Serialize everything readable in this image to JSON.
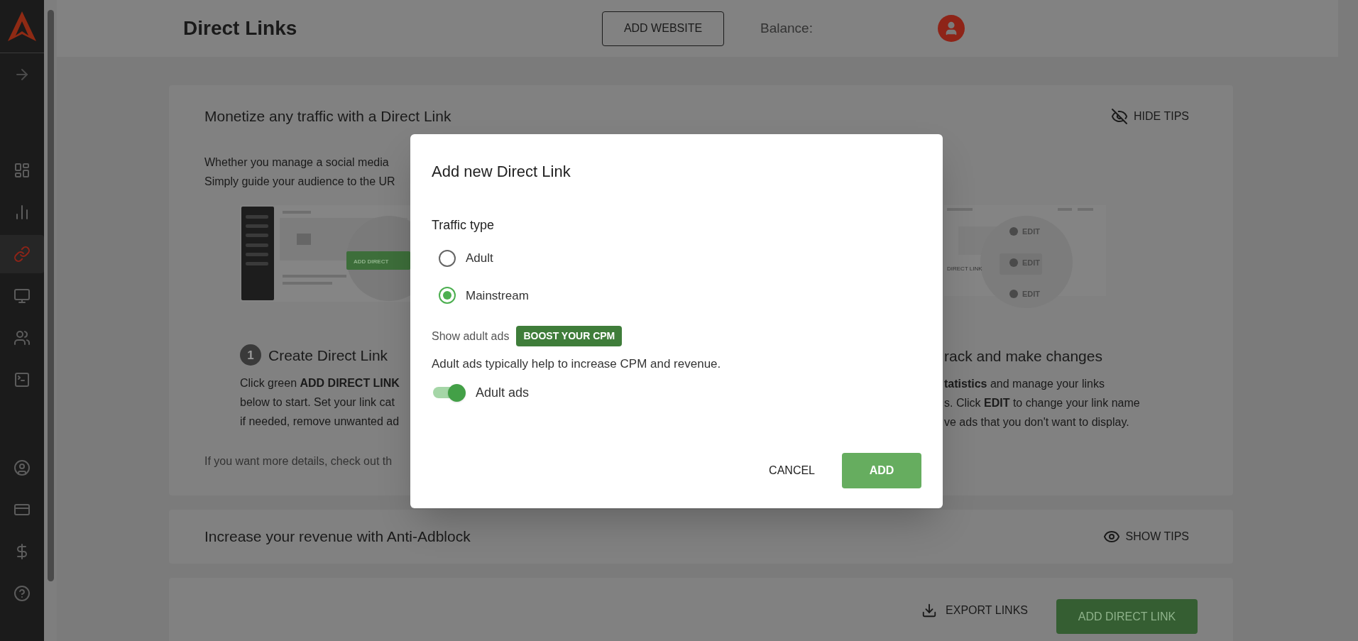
{
  "sidebar": {
    "items": [
      {
        "selected": false
      },
      {
        "selected": false
      },
      {
        "selected": true
      },
      {
        "selected": false
      },
      {
        "selected": false
      },
      {
        "selected": false
      }
    ],
    "bottom_items": [
      {
        "selected": false
      },
      {
        "selected": false
      },
      {
        "selected": false
      },
      {
        "selected": false
      }
    ]
  },
  "header": {
    "title": "Direct Links",
    "add_website": "ADD WEBSITE",
    "balance_label": "Balance:"
  },
  "tips_card": {
    "title": "Monetize any traffic with a Direct Link",
    "toggle": "HIDE TIPS",
    "intro": [
      "Whether you manage a social media",
      "Simply guide your audience to the UR"
    ],
    "illustration_left": {
      "button": "ADD DIRECT"
    },
    "illustration_right": {
      "buttons": [
        "EDIT",
        "EDIT",
        "EDIT"
      ],
      "row_label": "DIRECT LINK"
    },
    "steps": [
      {
        "number": "1",
        "title": "Create Direct Link",
        "lines": [
          "Click green **ADD DIRECT LINK**",
          "below to start. Set your link cat",
          "if needed, remove unwanted ad"
        ]
      },
      {
        "title": "rack and make changes",
        "lines": [
          "**tatistics** and manage your links",
          "s. Click **EDIT** to change your link name",
          "ve ads that you don't want to display."
        ]
      }
    ],
    "footer": "If you want more details, check out th"
  },
  "adblock_card": {
    "title": "Increase your revenue with Anti-Adblock",
    "toggle": "SHOW TIPS"
  },
  "actions": {
    "export": "EXPORT LINKS",
    "add": "ADD DIRECT LINK"
  },
  "dialog": {
    "title": "Add new Direct Link",
    "section": "Traffic type",
    "options": [
      {
        "label": "Adult",
        "selected": false
      },
      {
        "label": "Mainstream",
        "selected": true
      }
    ],
    "adult_ads_label": "Show adult ads",
    "badge": "BOOST YOUR CPM",
    "description": "Adult ads typically help to increase CPM and revenue.",
    "switch": {
      "label": "Adult ads",
      "on": true
    },
    "buttons": {
      "cancel": "CANCEL",
      "confirm": "ADD"
    }
  }
}
